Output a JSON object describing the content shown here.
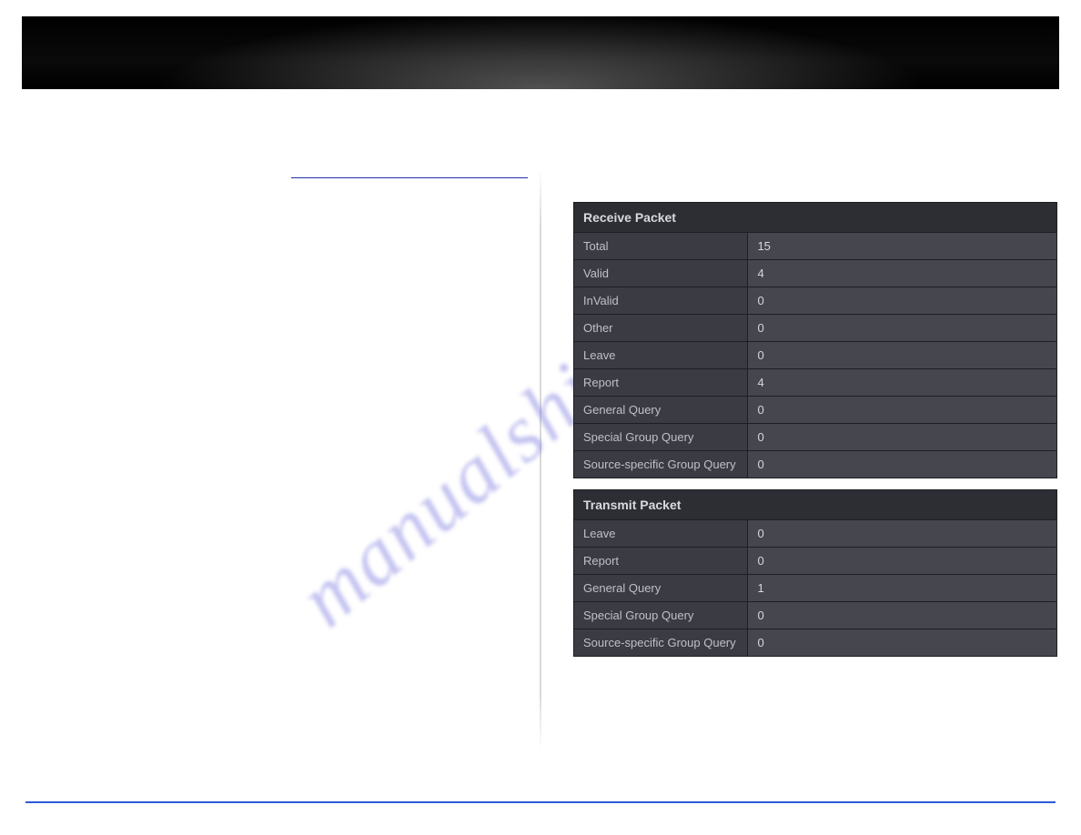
{
  "watermark": "manualshive.com",
  "receive": {
    "title": "Receive Packet",
    "rows": [
      {
        "label": "Total",
        "value": "15"
      },
      {
        "label": "Valid",
        "value": "4"
      },
      {
        "label": "InValid",
        "value": "0"
      },
      {
        "label": "Other",
        "value": "0"
      },
      {
        "label": "Leave",
        "value": "0"
      },
      {
        "label": "Report",
        "value": "4"
      },
      {
        "label": "General Query",
        "value": "0"
      },
      {
        "label": "Special Group Query",
        "value": "0"
      },
      {
        "label": "Source-specific Group Query",
        "value": "0"
      }
    ]
  },
  "transmit": {
    "title": "Transmit Packet",
    "rows": [
      {
        "label": "Leave",
        "value": "0"
      },
      {
        "label": "Report",
        "value": "0"
      },
      {
        "label": "General Query",
        "value": "1"
      },
      {
        "label": "Special Group Query",
        "value": "0"
      },
      {
        "label": "Source-specific Group Query",
        "value": "0"
      }
    ]
  }
}
